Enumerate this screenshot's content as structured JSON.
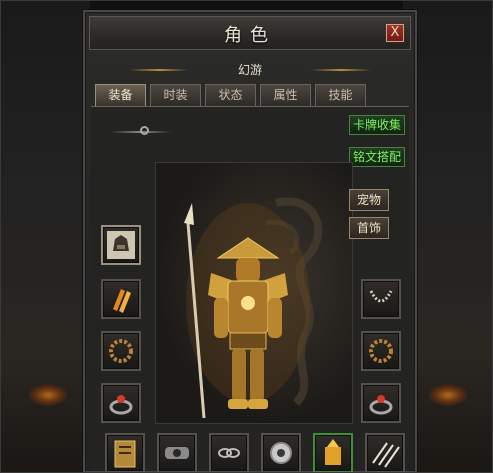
{
  "window": {
    "title": "角色",
    "close_label": "X"
  },
  "character": {
    "name": "幻游"
  },
  "tabs": [
    {
      "label": "装备",
      "active": true
    },
    {
      "label": "时装",
      "active": false
    },
    {
      "label": "状态",
      "active": false
    },
    {
      "label": "属性",
      "active": false
    },
    {
      "label": "技能",
      "active": false
    }
  ],
  "buttons": {
    "card_collection": "卡牌收集",
    "inscription": "铭文搭配",
    "pet": "宠物",
    "jewelry": "首饰"
  },
  "colors": {
    "accent_green": "#7cf15c",
    "gold": "#c99a3a",
    "close_red": "#9a3326"
  },
  "equipment": {
    "left_slots": [
      "helmet-icon",
      "bracer-icon",
      "bead-bracelet-icon",
      "ring-icon"
    ],
    "right_slots": [
      "necklace-icon",
      "bead-bracelet-icon",
      "ring-icon"
    ],
    "bottom_slots": [
      "tablet-icon",
      "belt-icon",
      "chain-icon",
      "gem-disc-icon",
      "golden-statue-icon",
      "claw-icon"
    ]
  }
}
